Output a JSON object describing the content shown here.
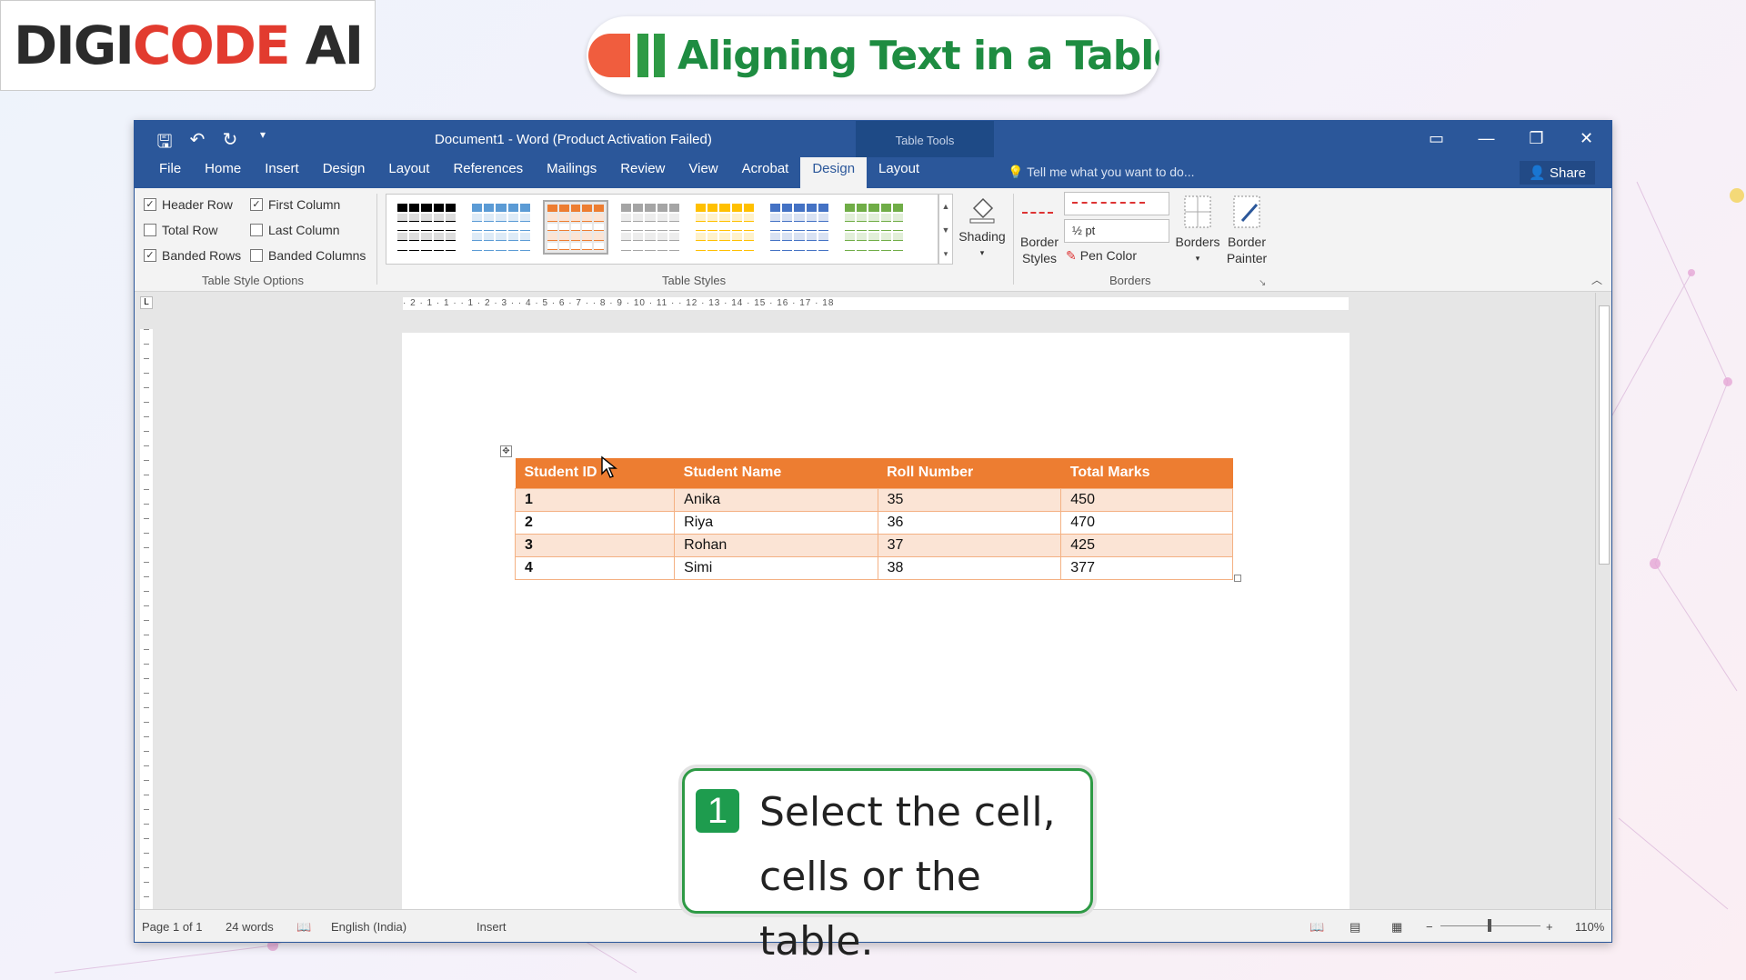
{
  "brand": {
    "logo_dark": "DIGI",
    "logo_red": "CODE",
    "logo_dark2": " AI"
  },
  "slide": {
    "title": "Aligning Text in a Table"
  },
  "window": {
    "title": "Document1 - Word (Product Activation Failed)",
    "context_tab_group": "Table Tools",
    "tabs": [
      "File",
      "Home",
      "Insert",
      "Design",
      "Layout",
      "References",
      "Mailings",
      "Review",
      "View",
      "Acrobat",
      "Design",
      "Layout"
    ],
    "active_tab_index": 10,
    "tell_me": "Tell me what you want to do...",
    "share": "Share"
  },
  "ribbon": {
    "table_style_options": {
      "label": "Table Style Options",
      "checks": [
        {
          "label": "Header Row",
          "checked": true
        },
        {
          "label": "First Column",
          "checked": true
        },
        {
          "label": "Total Row",
          "checked": false
        },
        {
          "label": "Last Column",
          "checked": false
        },
        {
          "label": "Banded Rows",
          "checked": true
        },
        {
          "label": "Banded Columns",
          "checked": false
        }
      ]
    },
    "table_styles": {
      "label": "Table Styles",
      "selected_index": 2
    },
    "shading": "Shading",
    "border_styles_line1": "Border",
    "border_styles_line2": "Styles",
    "pen_weight": "½ pt",
    "pen_color": "Pen Color",
    "borders": "Borders",
    "border_painter_line1": "Border",
    "border_painter_line2": "Painter",
    "borders_group_label": "Borders"
  },
  "ruler": {
    "marks": "· 2 · 1 · 1 · · 1 · 2 · 3 · · 4 · 5 · 6 · 7 · · 8 · 9 · 10 · 11 · · 12 · 13 · 14 · 15 · 16 · 17 · 18"
  },
  "table": {
    "headers": [
      "Student ID",
      "Student Name",
      "Roll Number",
      "Total Marks"
    ],
    "rows": [
      [
        "1",
        "Anika",
        "35",
        "450"
      ],
      [
        "2",
        "Riya",
        "36",
        "470"
      ],
      [
        "3",
        "Rohan",
        "37",
        "425"
      ],
      [
        "4",
        "Simi",
        "38",
        "377"
      ]
    ]
  },
  "callout": {
    "number": "1",
    "line1": "Select the cell,",
    "line2": "cells or the table."
  },
  "status": {
    "page": "Page 1 of 1",
    "words": "24 words",
    "language": "English (India)",
    "mode": "Insert",
    "zoom": "110%"
  },
  "colors": {
    "word_blue": "#2b579a",
    "table_header": "#ed7d31",
    "band": "#fbe4d5",
    "callout_green": "#2e9a45"
  }
}
